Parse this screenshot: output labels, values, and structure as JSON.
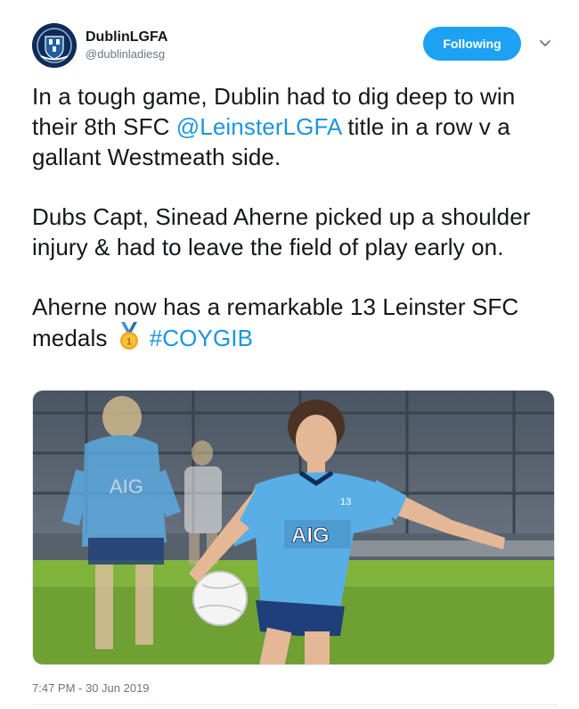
{
  "account": {
    "display_name": "DublinLGFA",
    "handle": "@dublinladiesg",
    "avatar_icon": "dublin-crest-icon"
  },
  "follow_button": {
    "label": "Following",
    "color": "#1da1f2"
  },
  "menu_icon": "chevron-down-icon",
  "tweet": {
    "p1_text": "In a tough game, Dublin had to dig deep to win their 8th SFC ",
    "p1_mention": "@LeinsterLGFA",
    "p1_text_end": " title in a row v a gallant Westmeath side.",
    "p2": "Dubs Capt, Sinead Aherne picked up a shoulder injury & had to leave the field of play early on.",
    "p3_text": "Aherne now has a remarkable 13 Leinster SFC medals",
    "p3_emoji": "medal-icon",
    "p3_hashtag": "#COYGIB"
  },
  "photo": {
    "jersey_sponsor": "AIG",
    "jersey_number": "13"
  },
  "timestamp": "7:47 PM - 30 Jun 2019",
  "colors": {
    "link": "#1b95e0",
    "jersey_blue": "#5aaee6",
    "navy": "#0f2c57",
    "grass": "#6fa034"
  }
}
